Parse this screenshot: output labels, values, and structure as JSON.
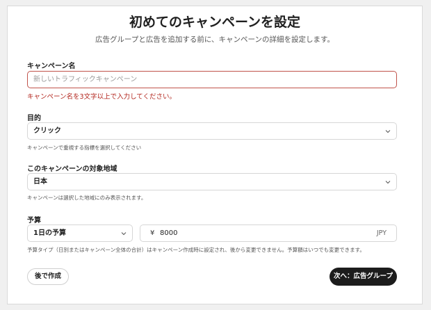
{
  "header": {
    "title": "初めてのキャンペーンを設定",
    "subtitle": "広告グループと広告を追加する前に、キャンペーンの詳細を設定します。"
  },
  "campaign_name": {
    "label": "キャンペーン名",
    "value": "",
    "placeholder": "新しいトラフィックキャンペーン",
    "error": "キャンペーン名を3文字以上で入力してください。"
  },
  "objective": {
    "label": "目的",
    "selected": "クリック",
    "help": "キャンペーンで重視する指標を選択してください"
  },
  "region": {
    "label": "このキャンペーンの対象地域",
    "selected": "日本",
    "help": "キャンペーンは選択した地域にのみ表示されます。"
  },
  "budget": {
    "label": "予算",
    "type_selected": "1日の予算",
    "currency_symbol": "¥",
    "amount": "8000",
    "currency_code": "JPY",
    "help": "予算タイプ（日別またはキャンペーン全体の合計）はキャンペーン作成時に設定され、後から変更できません。予算額はいつでも変更できます。"
  },
  "actions": {
    "later_label": "後で作成",
    "next_label": "次へ：広告グループ"
  },
  "colors": {
    "error": "#b3261e",
    "primary_button": "#1c1c1c"
  }
}
